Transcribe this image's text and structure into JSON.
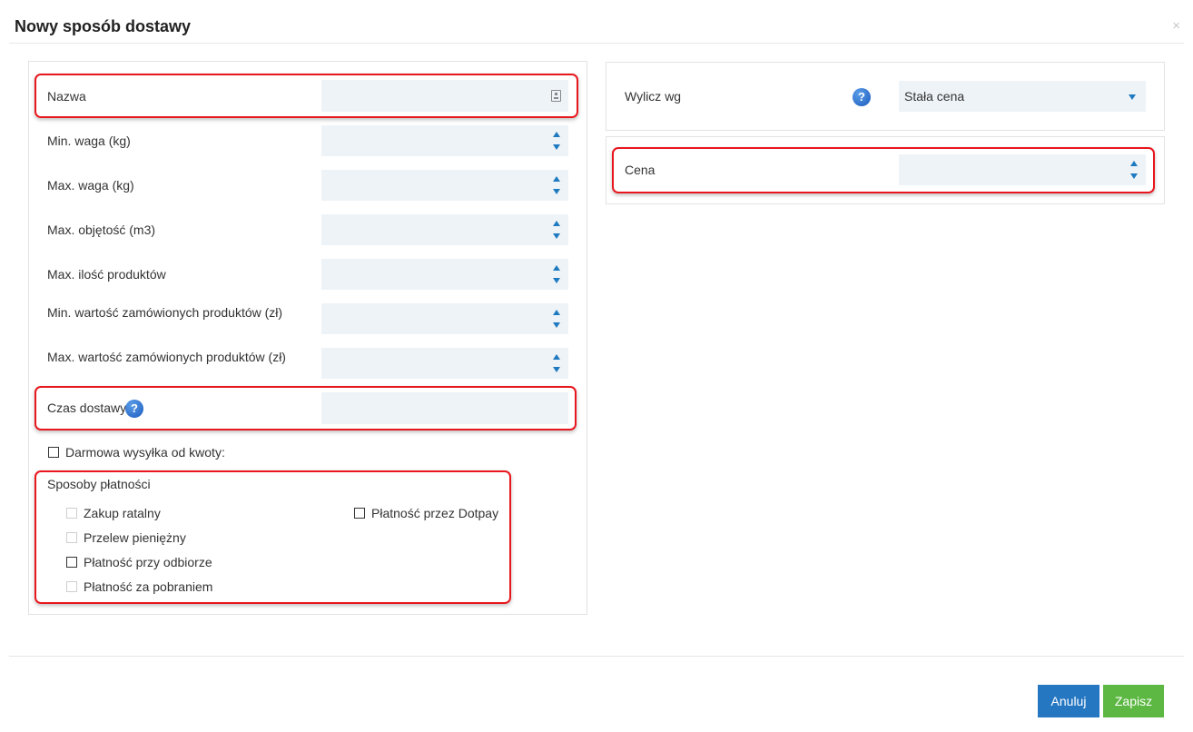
{
  "modal": {
    "title": "Nowy sposób dostawy",
    "close_glyph": "×"
  },
  "left": {
    "name_label": "Nazwa",
    "name_value": "",
    "fields": [
      {
        "label": "Min. waga (kg)",
        "value": ""
      },
      {
        "label": "Max. waga (kg)",
        "value": ""
      },
      {
        "label": "Max. objętość (m3)",
        "value": ""
      },
      {
        "label": "Max. ilość produktów",
        "value": ""
      },
      {
        "label": "Min. wartość zamówionych produktów (zł)",
        "value": ""
      },
      {
        "label": "Max. wartość zamówionych produktów (zł)",
        "value": ""
      }
    ],
    "delivery_time_label": "Czas dostawy",
    "delivery_time_value": "",
    "free_shipping_label": "Darmowa wysyłka od kwoty:",
    "free_shipping_checked": false,
    "payments_title": "Sposoby płatności",
    "payments": [
      {
        "label": "Zakup ratalny",
        "enabled": false,
        "checked": false
      },
      {
        "label": "Przelew pieniężny",
        "enabled": false,
        "checked": false
      },
      {
        "label": "Płatność przy odbiorze",
        "enabled": true,
        "checked": false
      },
      {
        "label": "Płatność za pobraniem",
        "enabled": false,
        "checked": false
      },
      {
        "label": "Płatność przez Dotpay",
        "enabled": true,
        "checked": false
      }
    ]
  },
  "right": {
    "calc_label": "Wylicz wg",
    "calc_selected": "Stała cena",
    "price_label": "Cena",
    "price_value": ""
  },
  "icons": {
    "help": "question-mark-help-icon",
    "name_field": "contact-card-icon",
    "spinner": "spinner-arrows-icon",
    "dropdown": "chevron-down-icon"
  },
  "colors": {
    "highlight": "#e8161d",
    "input_bg": "#eef3f7",
    "accent_blue": "#1e7ac0",
    "cancel_button": "#2677c2",
    "save_button": "#5cb842"
  },
  "help_glyph": "?",
  "footer": {
    "cancel_label": "Anuluj",
    "save_label": "Zapisz"
  }
}
